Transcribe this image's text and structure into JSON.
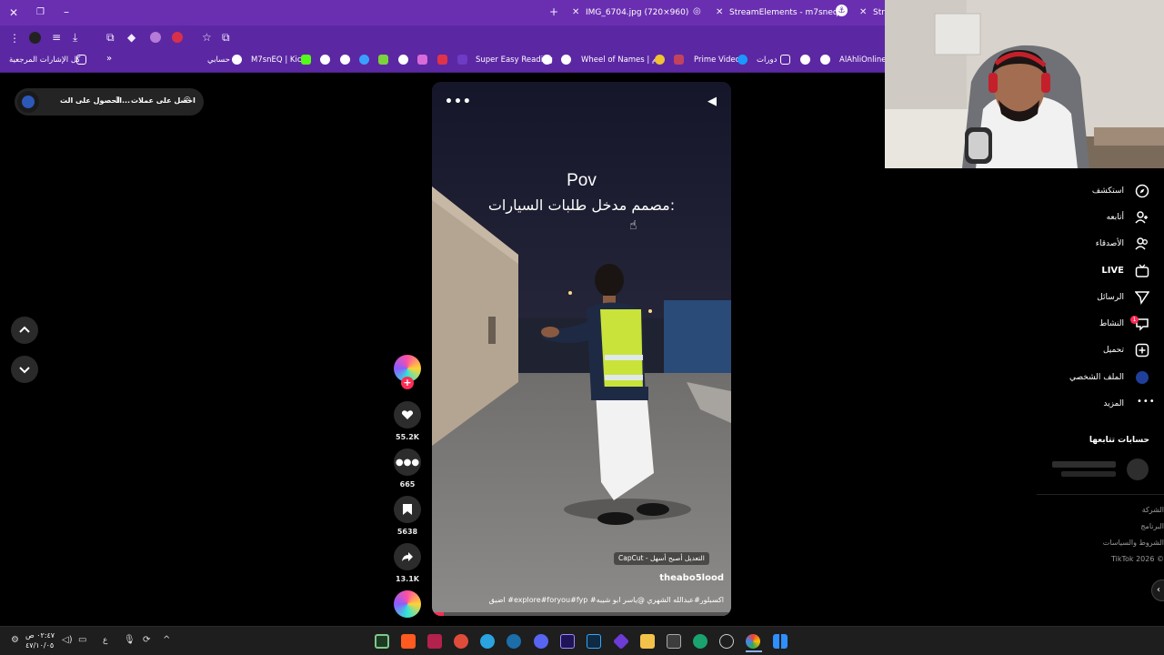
{
  "browser": {
    "tabs": [
      {
        "label": "IMG_6704.jpg (720×960)"
      },
      {
        "label": "StreamElements - m7sneq"
      },
      {
        "label": "Stre"
      }
    ],
    "bookmarks": [
      {
        "label": "كل الإشارات المرجعية"
      },
      {
        "label": "حسابي"
      },
      {
        "label": "M7snEQ | Kick"
      },
      {
        "label": "Super Easy Reading"
      },
      {
        "label": "Wheel of Names | م..."
      },
      {
        "label": "Prime Video"
      },
      {
        "label": "دورات"
      },
      {
        "label": "AlAhliOnline"
      }
    ]
  },
  "left_pill": {
    "item1": "احصل على عملات",
    "item2": "الحصول على الت..."
  },
  "video": {
    "caption_line1": "Pov",
    "caption_line2": "مصمم مدخل طلبات السيارات:",
    "capcut_label": "CapCut - التعديل أصبح أسهل",
    "author": "theabo5lood",
    "description": "اضيق  #explore#foryou#fyp #اكسبلور#عبدالله الشهري @ياسر ابو شيبه",
    "more_icon": "ellipsis-icon"
  },
  "actions": {
    "likes": "55.2K",
    "comments": "665",
    "saves": "5638",
    "shares": "13.1K"
  },
  "nav": {
    "items": [
      {
        "label": "استكشف"
      },
      {
        "label": "أتابعه"
      },
      {
        "label": "الأصدقاء"
      },
      {
        "label": "LIVE"
      },
      {
        "label": "الرسائل"
      },
      {
        "label": "النشاط"
      },
      {
        "label": "تحميل"
      },
      {
        "label": "الملف الشخصي"
      },
      {
        "label": "المزيد"
      }
    ],
    "following_title": "حسابات تتابعها",
    "footer": [
      "الشركة",
      "البرنامج",
      "الشروط والسياسات",
      "TikTok 2026 ©"
    ],
    "activity_badge": "1"
  },
  "taskbar": {
    "time": "٠٢:٤٧ ص",
    "date": "٤٧/١٠/٠٥",
    "lang": "ع"
  },
  "colors": {
    "browser_purple": "#6a2fb1",
    "tiktok_red": "#fe2c55",
    "vest_yellow": "#c9e33a"
  }
}
